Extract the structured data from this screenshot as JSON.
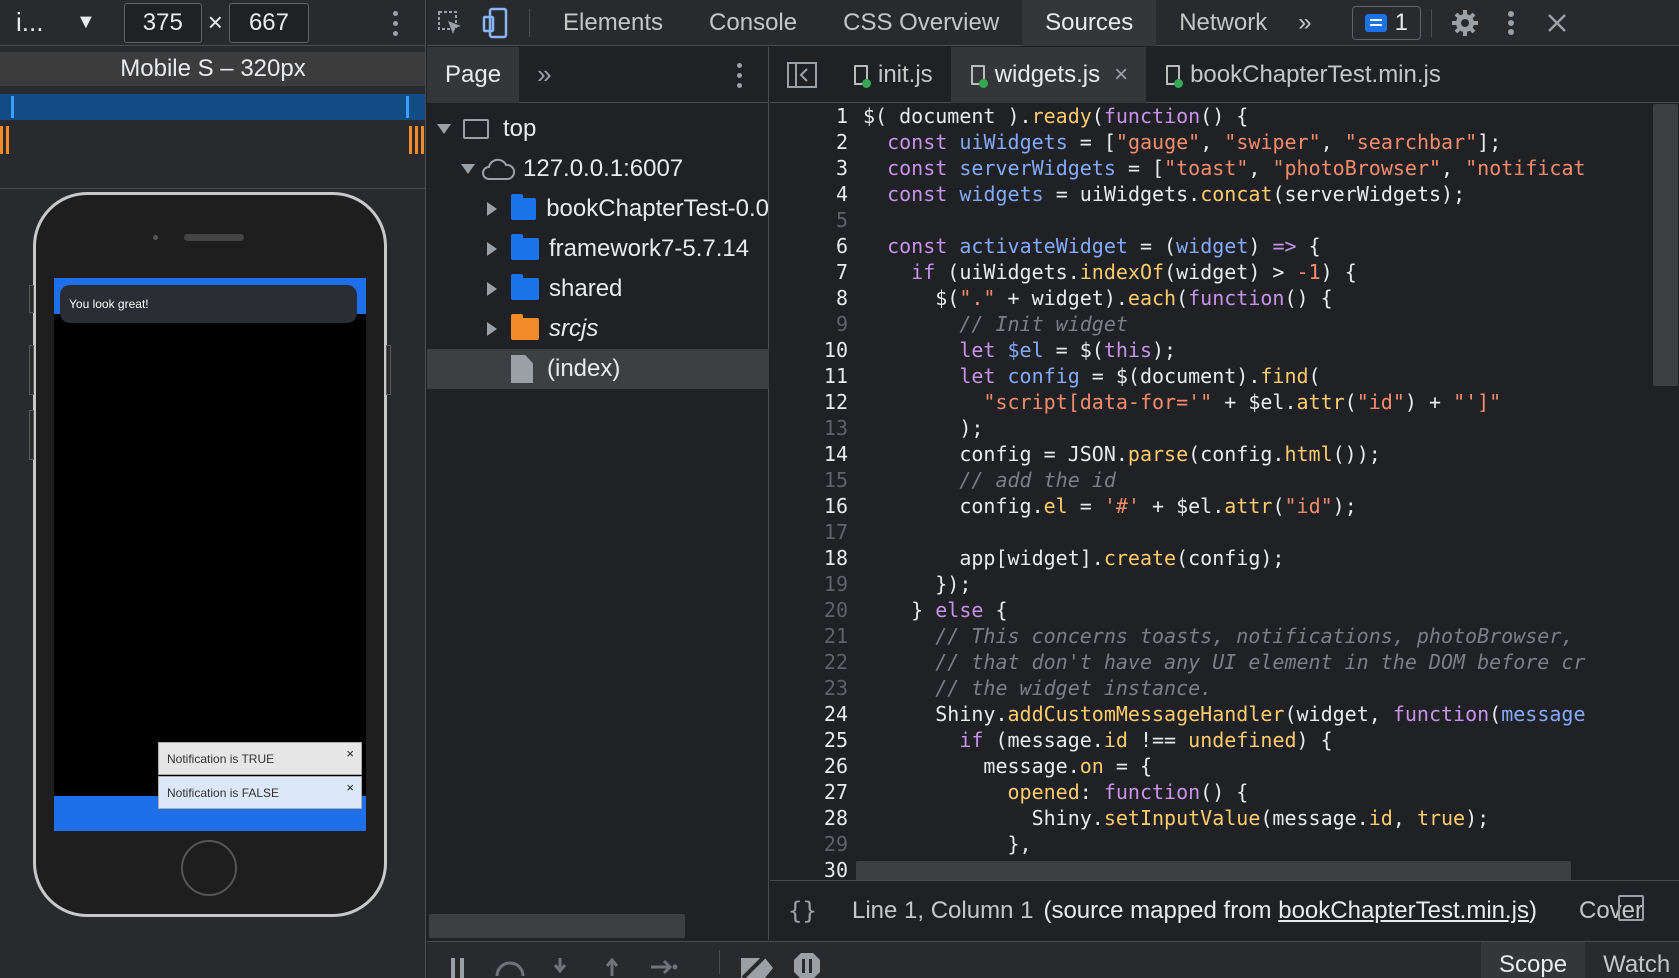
{
  "device_toolbar": {
    "device_name": "i...",
    "width_value": "375",
    "height_value": "667",
    "times": "×"
  },
  "preset_label": "Mobile S – 320px",
  "phone_screen": {
    "toast_text": "You look great!",
    "notification_true": "Notification is TRUE",
    "notification_false": "Notification is FALSE",
    "close_glyph": "×"
  },
  "devtools_tabs": [
    {
      "label": "Elements"
    },
    {
      "label": "Console"
    },
    {
      "label": "CSS Overview"
    },
    {
      "label": "Sources"
    },
    {
      "label": "Network"
    }
  ],
  "more_tabs": "»",
  "issues_count": "1",
  "navigator": {
    "tab_label": "Page",
    "more": "»",
    "tree": [
      {
        "label": "top",
        "kind": "frame"
      },
      {
        "label": "127.0.0.1:6007",
        "kind": "cloud"
      },
      {
        "label": "bookChapterTest-0.0",
        "kind": "folder"
      },
      {
        "label": "framework7-5.7.14",
        "kind": "folder"
      },
      {
        "label": "shared",
        "kind": "folder"
      },
      {
        "label": "srcjs",
        "kind": "folder-orange"
      },
      {
        "label": "(index)",
        "kind": "file"
      }
    ]
  },
  "editor_tabs": [
    {
      "label": "init.js"
    },
    {
      "label": "widgets.js",
      "close": "×"
    },
    {
      "label": "bookChapterTest.min.js"
    }
  ],
  "code_lines": [
    "1",
    "2",
    "3",
    "4",
    "5",
    "6",
    "7",
    "8",
    "9",
    "10",
    "11",
    "12",
    "13",
    "14",
    "15",
    "16",
    "17",
    "18",
    "19",
    "20",
    "21",
    "22",
    "23",
    "24",
    "25",
    "26",
    "27",
    "28",
    "29",
    "30"
  ],
  "status_bar": {
    "braces": "{}",
    "position": "Line 1, Column 1",
    "mapped_prefix": "(source mapped from ",
    "mapped_link": "bookChapterTest.min.js",
    "mapped_suffix": ")",
    "coverage": "Cover"
  },
  "debug_tabs": [
    {
      "label": "Scope"
    },
    {
      "label": "Watch"
    }
  ],
  "colors": {
    "accent_blue": "#1f6fea",
    "orange": "#f28b2a",
    "keyword": "#c792ea",
    "function": "#ffcb6b",
    "string": "#f78c6c"
  }
}
